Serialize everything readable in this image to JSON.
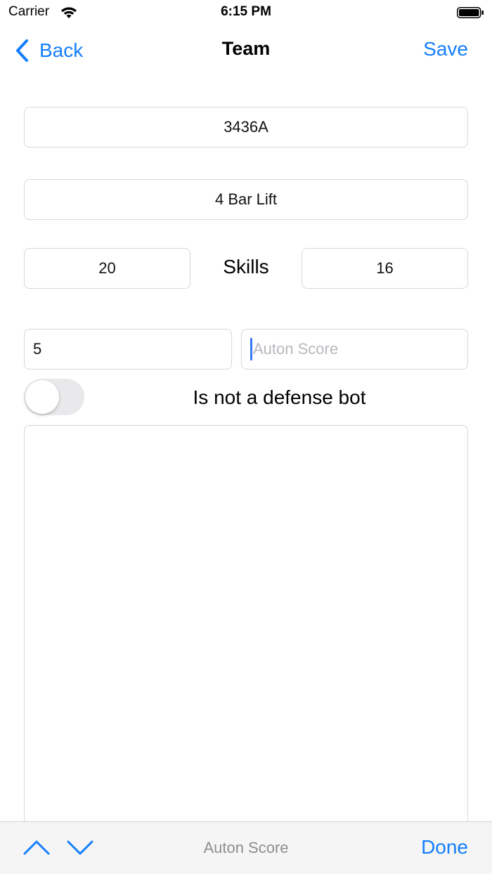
{
  "status_bar": {
    "carrier": "Carrier",
    "time": "6:15 PM"
  },
  "nav": {
    "back_label": "Back",
    "title": "Team",
    "save_label": "Save"
  },
  "form": {
    "team_number": "3436A",
    "lift_type": "4 Bar Lift",
    "skills_left": "20",
    "skills_label": "Skills",
    "skills_right": "16",
    "score_value": "5",
    "auton_placeholder": "Auton Score",
    "defense_toggle_on": false,
    "defense_label": "Is not a defense bot",
    "notes": ""
  },
  "accessory_toolbar": {
    "field_label": "Auton Score",
    "done_label": "Done"
  },
  "colors": {
    "accent": "#147efb",
    "caret": "#3478f6",
    "placeholder": "#b8b8be"
  }
}
